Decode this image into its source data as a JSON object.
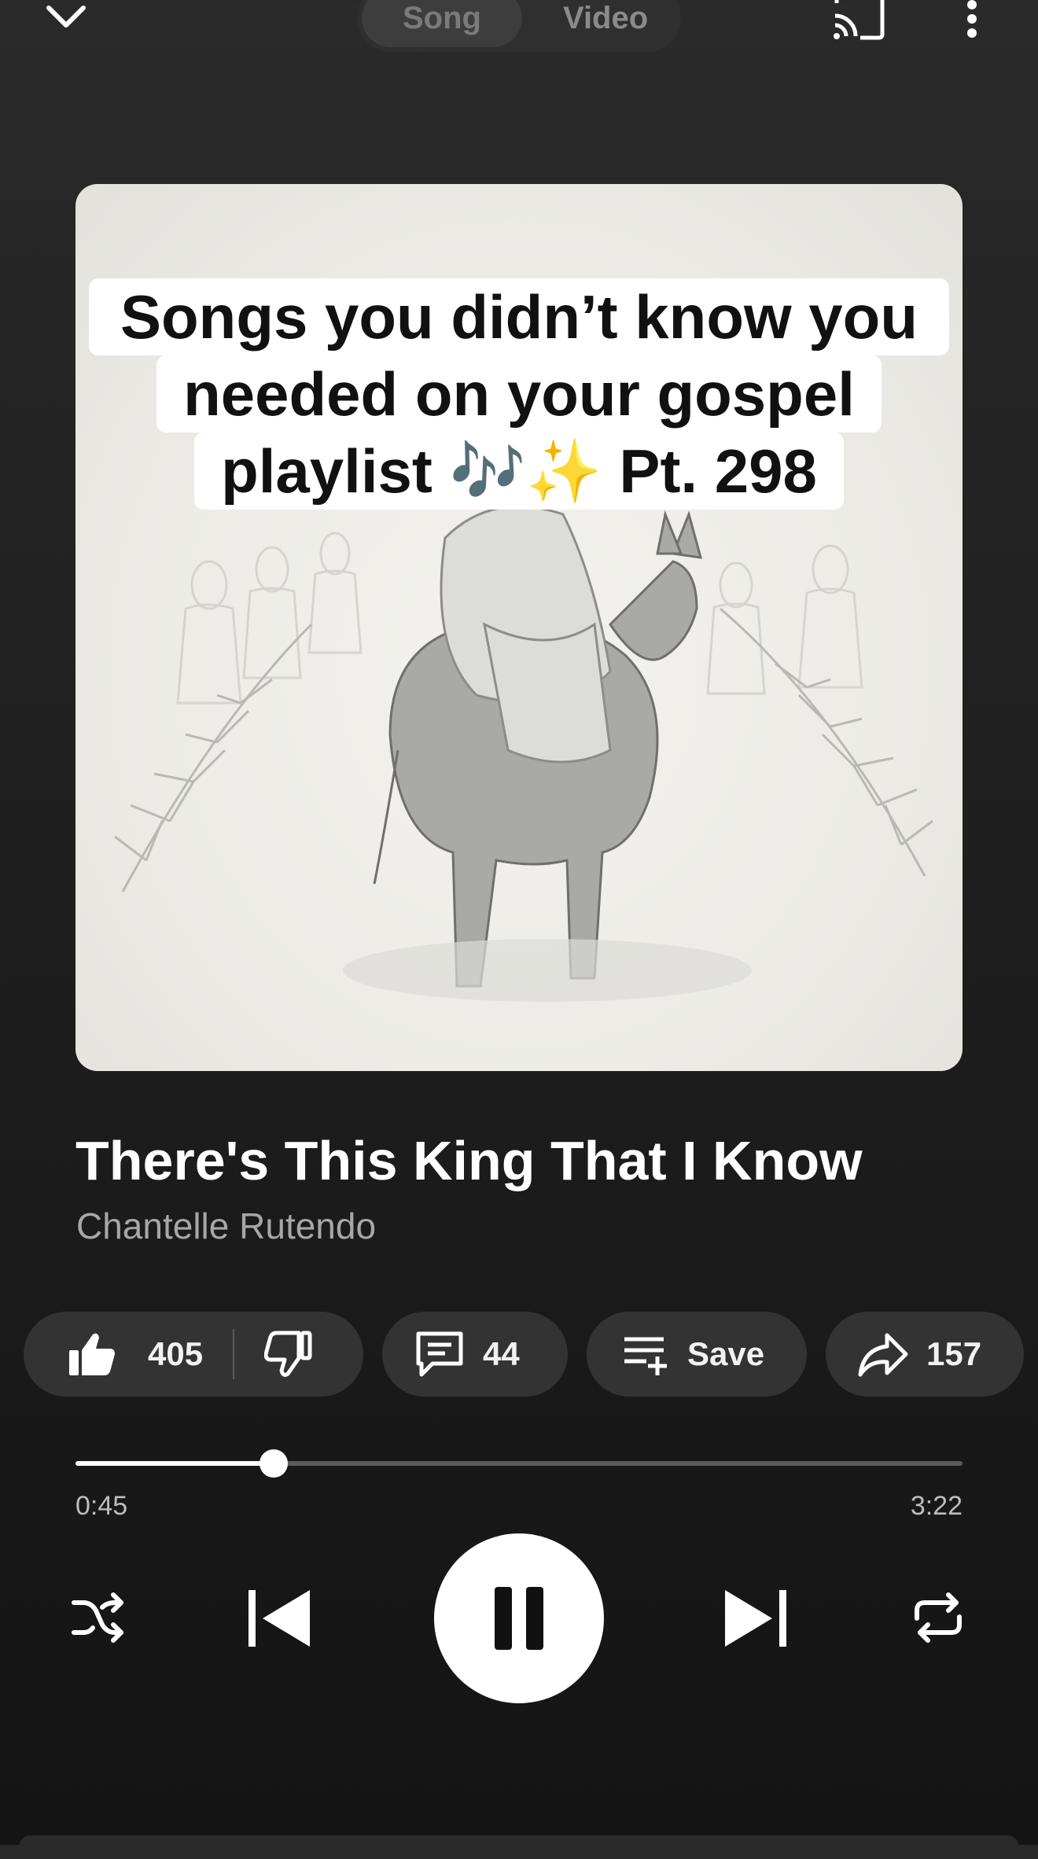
{
  "top_bar": {
    "toggle": {
      "song_label": "Song",
      "video_label": "Video",
      "selected": "Song"
    }
  },
  "artwork": {
    "caption_lines": [
      "Songs you didn’t know you",
      "needed on your gospel",
      "playlist 🎶✨ Pt. 298"
    ]
  },
  "track": {
    "title": "There's This King That I Know",
    "artist": "Chantelle Rutendo"
  },
  "actions": {
    "likes": "405",
    "comments": "44",
    "save_label": "Save",
    "shares": "157"
  },
  "playback": {
    "elapsed": "0:45",
    "duration": "3:22",
    "progress_fraction": 0.223,
    "state": "playing"
  },
  "colors": {
    "background": "#1f1f1f",
    "chip": "#333333",
    "accent": "#ffffff"
  },
  "icons": [
    "chevron-down-icon",
    "cast-icon",
    "more-vert-icon",
    "thumb-up-icon",
    "thumb-down-icon",
    "comment-icon",
    "playlist-add-icon",
    "share-icon",
    "shuffle-icon",
    "skip-previous-icon",
    "pause-icon",
    "skip-next-icon",
    "repeat-icon"
  ]
}
